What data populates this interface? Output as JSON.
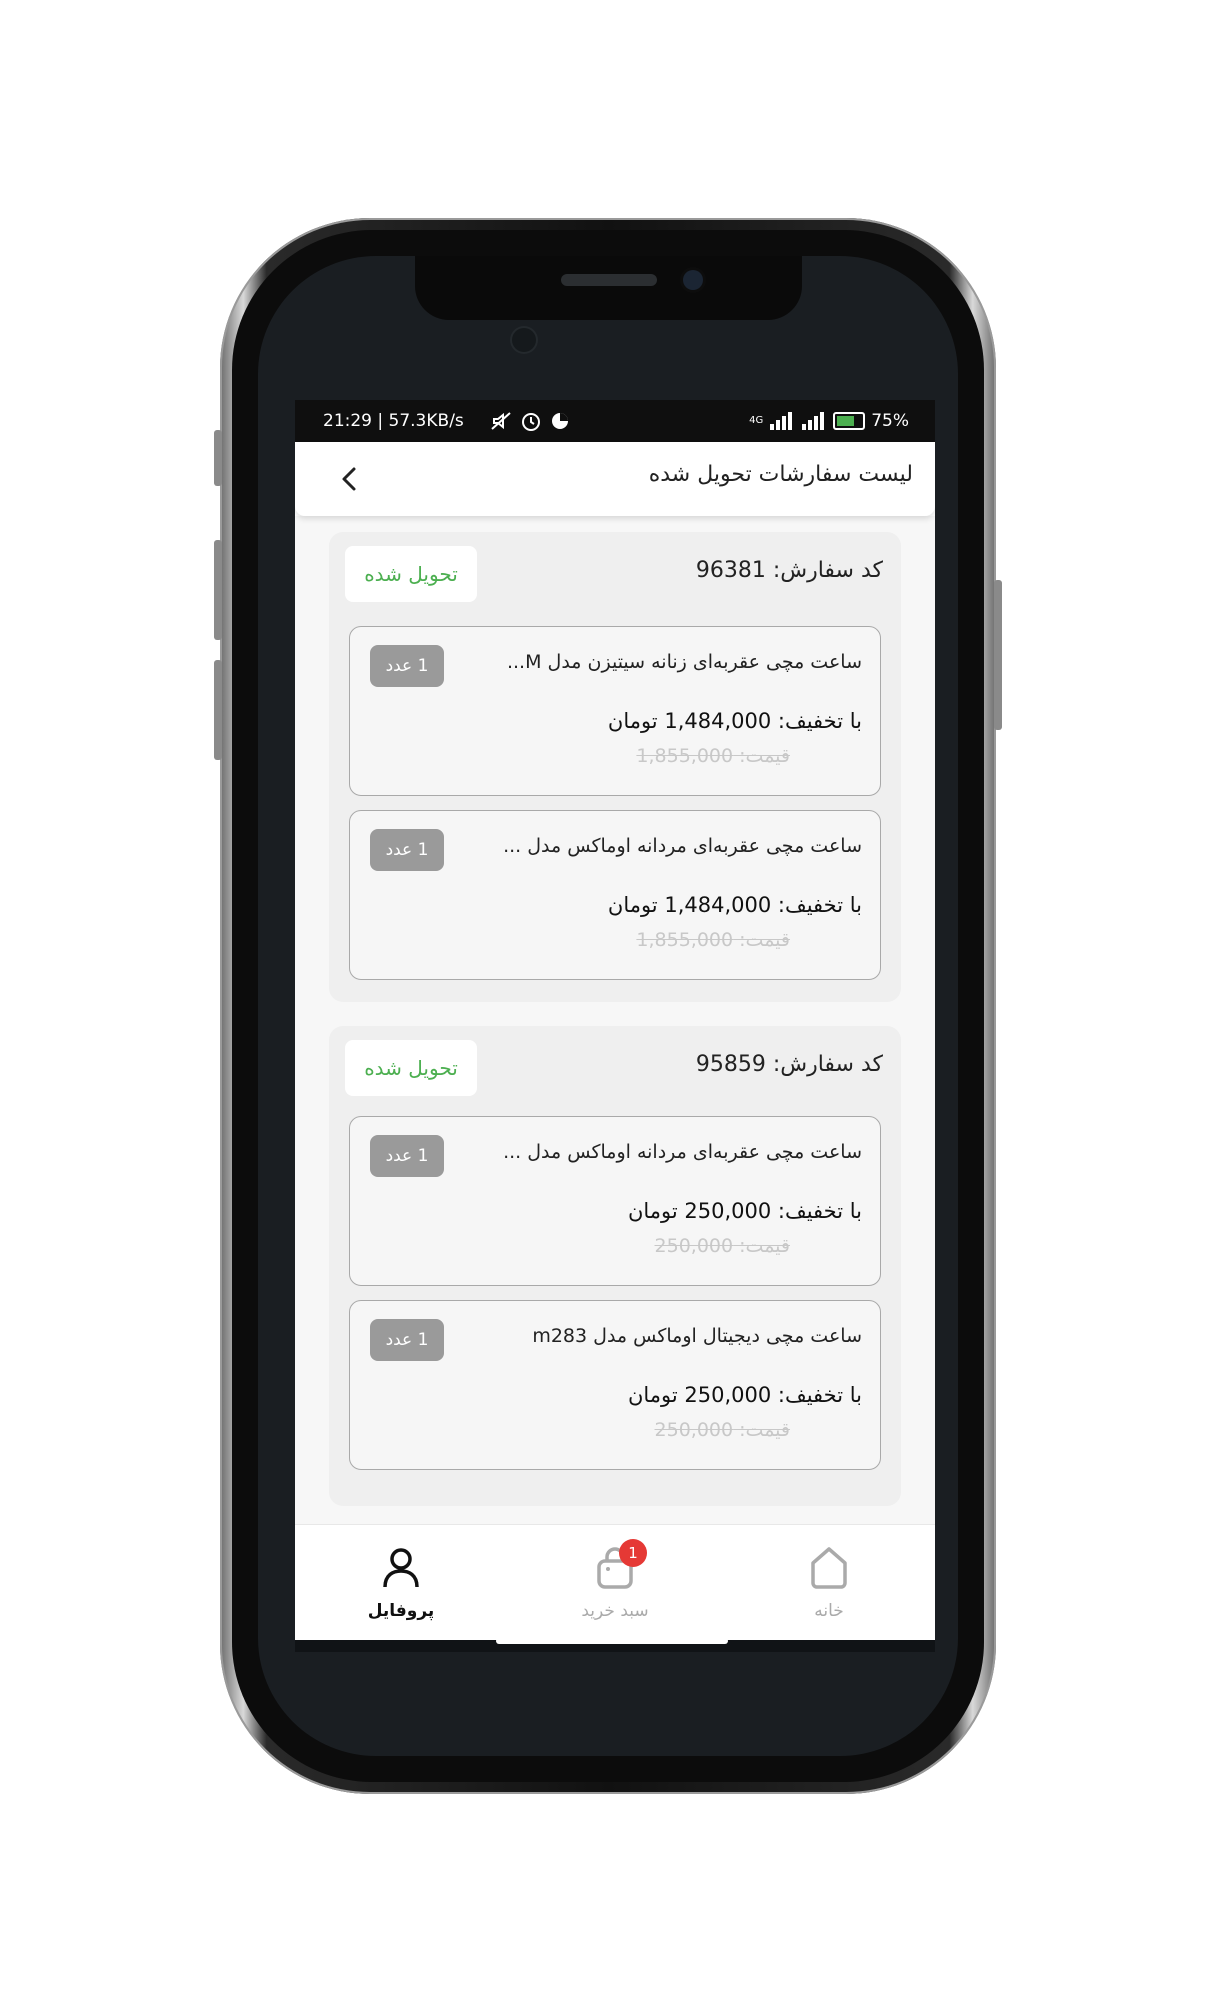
{
  "status_bar": {
    "left_text": "21:29 | 57.3KB/s",
    "network": "4G",
    "battery": "75%"
  },
  "header": {
    "title": "لیست سفارشات تحویل شده",
    "back_icon": "chevron-left-icon"
  },
  "orders": [
    {
      "code_label": "کد سفارش: 96381",
      "status": "تحویل شده",
      "items": [
        {
          "name": "ساعت مچی عقربه‌ای زنانه سیتیزن مدل M...",
          "qty": "1 عدد",
          "discount_price": "با تخفیف: 1,484,000 تومان",
          "original_price": "قیمت: 1,855,000"
        },
        {
          "name": "ساعت مچی عقربه‌ای مردانه اوماکس مدل ...",
          "qty": "1 عدد",
          "discount_price": "با تخفیف: 1,484,000 تومان",
          "original_price": "قیمت: 1,855,000"
        }
      ]
    },
    {
      "code_label": "کد سفارش: 95859",
      "status": "تحویل شده",
      "items": [
        {
          "name": "ساعت مچی عقربه‌ای مردانه اوماکس مدل ...",
          "qty": "1 عدد",
          "discount_price": "با تخفیف: 250,000 تومان",
          "original_price": "قیمت: 250,000"
        },
        {
          "name": "ساعت مچی دیجیتال اوماکس مدل m283",
          "qty": "1 عدد",
          "discount_price": "با تخفیف: 250,000 تومان",
          "original_price": "قیمت: 250,000"
        }
      ]
    }
  ],
  "tab_bar": {
    "profile": {
      "label": "پروفایل",
      "icon": "user-icon"
    },
    "cart": {
      "label": "سبد خرید",
      "icon": "shopping-bag-icon",
      "badge": "1"
    },
    "home": {
      "label": "خانه",
      "icon": "home-icon"
    }
  },
  "colors": {
    "status_green": "#4caf50",
    "qty_badge_gray": "#9a9a9a",
    "cart_badge_red": "#e53935"
  }
}
